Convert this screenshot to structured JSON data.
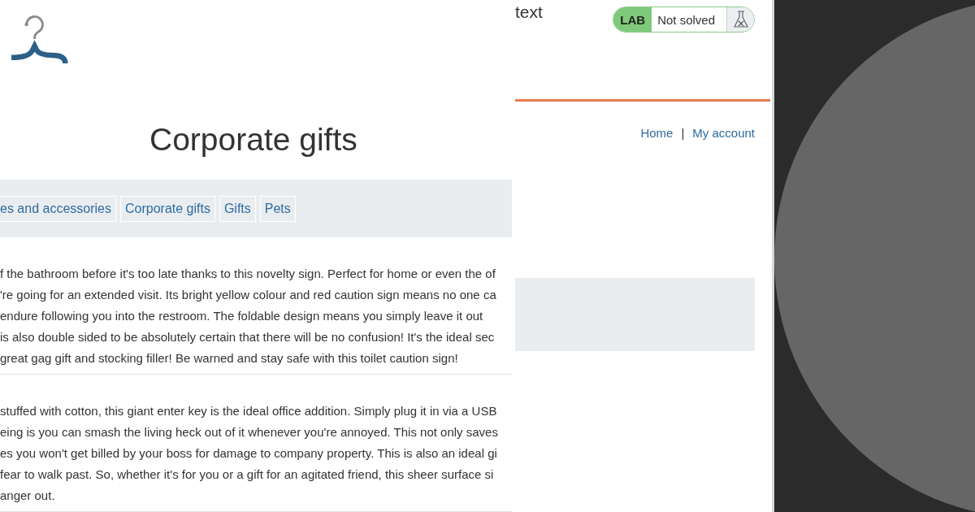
{
  "left_page": {
    "heading": "Corporate gifts",
    "categories": [
      {
        "label": "es and accessories"
      },
      {
        "label": "Corporate gifts"
      },
      {
        "label": "Gifts"
      },
      {
        "label": "Pets"
      }
    ],
    "products": [
      {
        "lines": [
          "f the bathroom before it's too late thanks to this novelty sign. Perfect for home or even the of",
          "'re going for an extended visit. Its bright yellow colour and red caution sign means no one ca",
          "endure following you into the restroom. The foldable design means you simply leave it out",
          "is also double sided to be absolutely certain that there will be no confusion! It's the ideal sec",
          "great gag gift and stocking filler! Be warned and stay safe with this toilet caution sign!"
        ]
      },
      {
        "lines": [
          "stuffed with cotton, this giant enter key is the ideal office addition. Simply plug it in via a USB",
          "eing is you can smash the living heck out of it whenever you're annoyed. This not only saves",
          "es you won't get billed by your boss for damage to company property. This is also an ideal gi",
          "fear to walk past. So, whether it's for you or a gift for an agitated friend, this sheer surface si",
          "anger out."
        ]
      }
    ]
  },
  "right_page": {
    "title": "text",
    "lab": {
      "tag": "LAB",
      "status": "Not solved"
    },
    "links": [
      "Home",
      "My account"
    ],
    "separator": "|"
  }
}
